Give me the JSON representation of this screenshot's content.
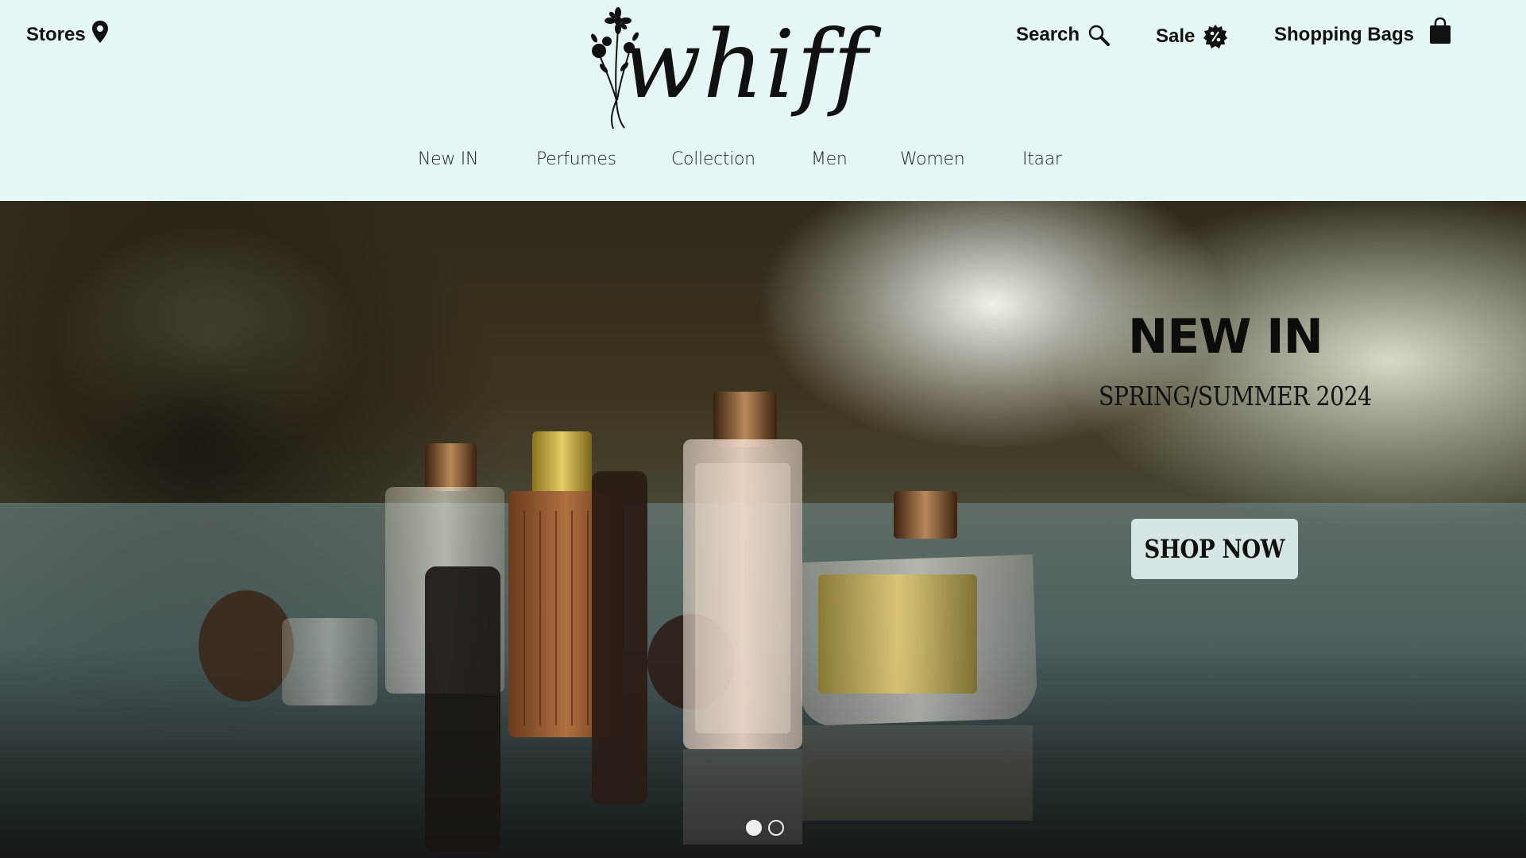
{
  "header": {
    "stores_label": "Stores",
    "logo_text": "whiff",
    "search_label": "Search",
    "sale_label": "Sale",
    "bags_label": "Shopping Bags",
    "icons": [
      "map-pin-icon",
      "search-icon",
      "sale-badge-icon",
      "shopping-bag-icon",
      "flower-icon"
    ]
  },
  "nav": {
    "items": [
      {
        "label": "New IN"
      },
      {
        "label": "Perfumes"
      },
      {
        "label": "Collection"
      },
      {
        "label": "Men"
      },
      {
        "label": "Women"
      },
      {
        "label": "Itaar"
      }
    ]
  },
  "hero": {
    "title": "NEW IN",
    "subtitle": "SPRING/SUMMER 2024",
    "cta_label": "SHOP NOW",
    "slide_count": 2,
    "active_slide": 1
  },
  "colors": {
    "header_bg": "#e4f6f5",
    "text": "#111111",
    "cta_bg": "#e1f0f0"
  }
}
